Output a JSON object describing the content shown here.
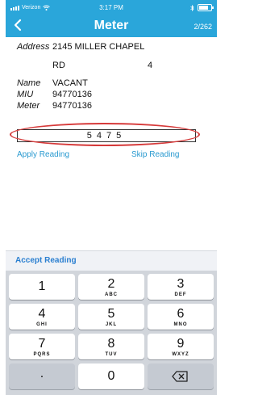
{
  "status": {
    "carrier": "Verizon",
    "time": "3:17 PM"
  },
  "nav": {
    "back_icon": "chevron-left-icon",
    "title": "Meter",
    "count": "2/262"
  },
  "details": {
    "address_label": "Address",
    "address_line1": "2145 MILLER CHAPEL",
    "address_line2": "RD",
    "address_unit": "4",
    "name_label": "Name",
    "name_value": "VACANT",
    "miu_label": "MIU",
    "miu_value": "94770136",
    "meter_label": "Meter",
    "meter_value": "94770136"
  },
  "reading": {
    "value": "5475"
  },
  "actions": {
    "apply": "Apply Reading",
    "skip": "Skip Reading",
    "accept": "Accept Reading"
  },
  "keypad": {
    "k1": "1",
    "k2": "2",
    "k2_letters": "ABC",
    "k3": "3",
    "k3_letters": "DEF",
    "k4": "4",
    "k4_letters": "GHI",
    "k5": "5",
    "k5_letters": "JKL",
    "k6": "6",
    "k6_letters": "MNO",
    "k7": "7",
    "k7_letters": "PQRS",
    "k8": "8",
    "k8_letters": "TUV",
    "k9": "9",
    "k9_letters": "WXYZ",
    "dot": ".",
    "k0": "0",
    "delete_icon": "backspace-icon"
  },
  "colors": {
    "header": "#2aa6da",
    "link": "#2a9ad0",
    "highlight": "#d63a3a"
  }
}
